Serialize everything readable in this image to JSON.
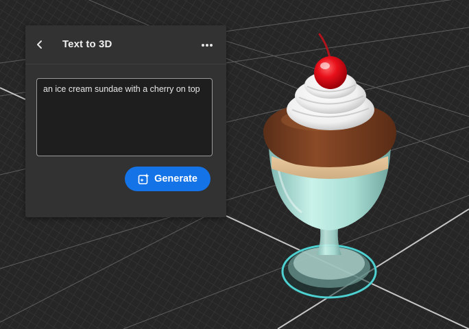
{
  "panel": {
    "title": "Text to 3D",
    "back_icon": "chevron-left-icon",
    "more_icon": "more-horizontal-icon"
  },
  "prompt": {
    "value": "an ice cream sundae with a cherry on top"
  },
  "generate": {
    "label": "Generate",
    "icon": "sparkle-generate-icon"
  },
  "colors": {
    "accent": "#1473e6",
    "panel_bg": "#323232",
    "canvas_bg": "#2a2a2a"
  }
}
